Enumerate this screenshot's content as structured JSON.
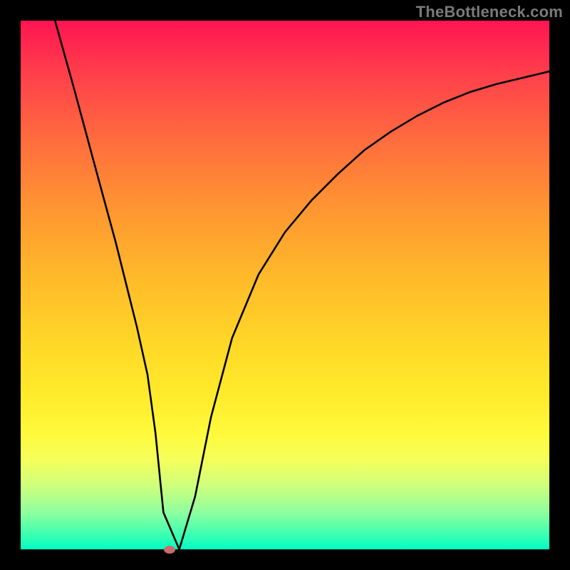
{
  "watermark": "TheBottleneck.com",
  "colors": {
    "background": "#000000",
    "gradient_top": "#ff1452",
    "gradient_bottom": "#00ffc3",
    "curve": "#000000",
    "dot": "#cd6a6a"
  },
  "chart_data": {
    "type": "line",
    "title": "",
    "xlabel": "",
    "ylabel": "",
    "xlim": [
      0,
      100
    ],
    "ylim": [
      0,
      100
    ],
    "grid": false,
    "series": [
      {
        "name": "bottleneck-curve",
        "x": [
          6.5,
          10,
          15,
          18,
          20,
          22,
          24,
          25.5,
          27,
          30,
          33,
          36,
          40,
          45,
          50,
          55,
          60,
          65,
          70,
          75,
          80,
          85,
          90,
          95,
          100
        ],
        "y": [
          100,
          87.5,
          69,
          58,
          50,
          42,
          33,
          22,
          7,
          0,
          10,
          25,
          40,
          52,
          60,
          66,
          71,
          75.5,
          79,
          82,
          84.5,
          86.5,
          88,
          89.2,
          90.4
        ]
      }
    ],
    "annotations": [
      {
        "name": "minimum-marker",
        "x": 28.2,
        "y": 0
      }
    ]
  }
}
